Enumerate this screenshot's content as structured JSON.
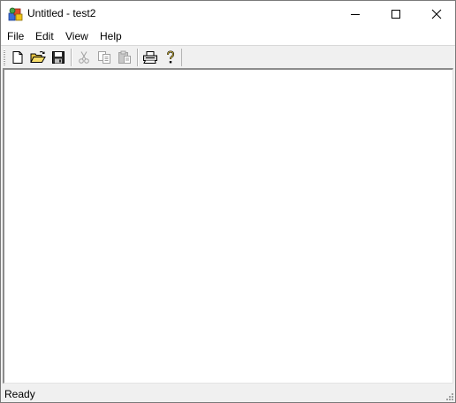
{
  "window": {
    "title": "Untitled - test2"
  },
  "menubar": {
    "items": [
      {
        "label": "File"
      },
      {
        "label": "Edit"
      },
      {
        "label": "View"
      },
      {
        "label": "Help"
      }
    ]
  },
  "toolbar": {
    "buttons": [
      {
        "icon": "new-document-icon",
        "enabled": true
      },
      {
        "icon": "open-folder-icon",
        "enabled": true
      },
      {
        "icon": "save-disk-icon",
        "enabled": true
      },
      {
        "icon": "cut-scissors-icon",
        "enabled": false
      },
      {
        "icon": "copy-icon",
        "enabled": false
      },
      {
        "icon": "paste-icon",
        "enabled": false
      },
      {
        "icon": "print-icon",
        "enabled": true
      },
      {
        "icon": "help-question-icon",
        "enabled": true
      }
    ]
  },
  "statusbar": {
    "text": "Ready"
  },
  "colors": {
    "title_bg": "#ffffff",
    "chrome_bg": "#f0f0f0",
    "client_bg": "#ffffff"
  }
}
